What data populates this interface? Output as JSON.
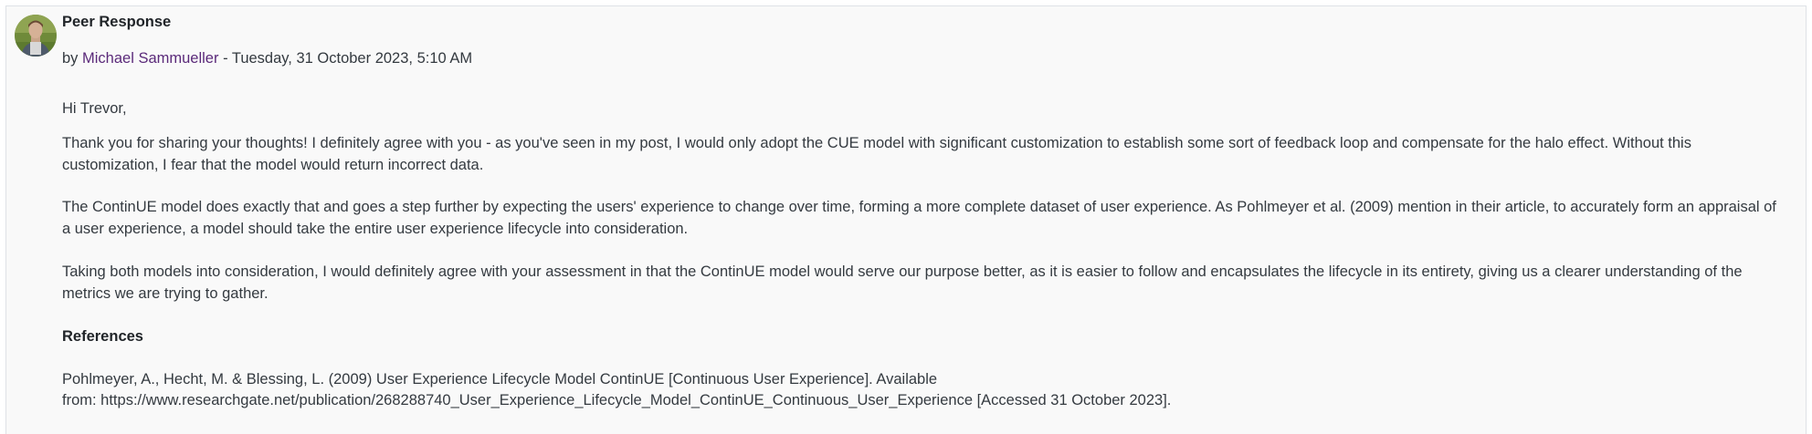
{
  "post": {
    "subject": "Peer Response",
    "byline_prefix": "by ",
    "author": "Michael Sammueller",
    "date_sep": " - ",
    "date": "Tuesday, 31 October 2023, 5:10 AM",
    "greeting": "Hi Trevor,",
    "para1": "Thank you for sharing your thoughts! I definitely agree with you - as you've seen in my post, I would only adopt the CUE model with significant customization to establish some sort of feedback loop and compensate for the halo effect. Without this customization, I fear that the model would return incorrect data.",
    "para2": "The ContinUE model does exactly that and goes a step further by expecting the users' experience to change over time, forming a more complete dataset of user experience. As Pohlmeyer et al. (2009) mention in their article, to accurately form an appraisal of a user experience, a model should take the entire user experience lifecycle into consideration.",
    "para3": "Taking both models into consideration, I would definitely agree with your assessment in that the ContinUE model would serve our purpose better, as it is easier to follow and encapsulates the lifecycle in its entirety, giving us a clearer understanding of the metrics we are trying to gather.",
    "references_heading": "References",
    "reference_line1": "Pohlmeyer, A., Hecht, M. & Blessing, L. (2009) User Experience Lifecycle Model ContinUE [Continuous User Experience]. Available",
    "reference_line2": "from: https://www.researchgate.net/publication/268288740_User_Experience_Lifecycle_Model_ContinUE_Continuous_User_Experience [Accessed 31 October 2023]."
  },
  "colors": {
    "author_link": "#5b2a7a",
    "post_background": "#f9f9f9",
    "border": "#dee2e6"
  }
}
